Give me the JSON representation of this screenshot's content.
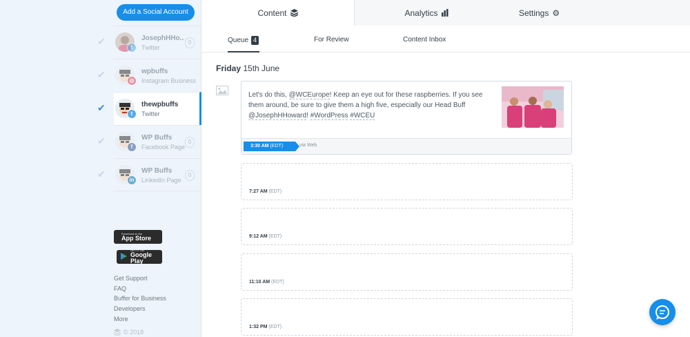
{
  "sidebar": {
    "add_account_label": "Add a Social Account",
    "accounts": [
      {
        "name": "JosephHHo...",
        "type": "Twitter",
        "count": "0",
        "network": "twitter",
        "active": false
      },
      {
        "name": "wpbuffs",
        "type": "Instagram Business",
        "count": "",
        "network": "instagram",
        "active": false
      },
      {
        "name": "thewpbuffs",
        "type": "Twitter",
        "count": "",
        "network": "twitter",
        "active": true
      },
      {
        "name": "WP Buffs",
        "type": "Facebook Page",
        "count": "0",
        "network": "facebook",
        "active": false
      },
      {
        "name": "WP Buffs",
        "type": "LinkedIn Page",
        "count": "0",
        "network": "linkedin",
        "active": false
      }
    ],
    "app_store": {
      "small": "Download on the",
      "big": "App Store"
    },
    "google_play": {
      "small": "GET IT ON",
      "big": "Google Play"
    },
    "footer_links": [
      "Get Support",
      "FAQ",
      "Buffer for Business",
      "Developers",
      "More"
    ],
    "copyright": "© 2018"
  },
  "top_tabs": {
    "content": "Content",
    "analytics": "Analytics",
    "settings": "Settings"
  },
  "sub_tabs": {
    "queue": "Queue",
    "queue_count": "4",
    "for_review": "For Review",
    "content_inbox": "Content Inbox"
  },
  "queue": {
    "day": "Friday",
    "date": "15th June",
    "post": {
      "text_1": "Let's do this, ",
      "mention_1": "@WCEurope",
      "text_2": "! Keep an eye out for these raspberries. If you see them around, be sure to give them a high five, especially our Head Buff ",
      "mention_2": "@JosephHHoward",
      "text_3": "! ",
      "hashtag_1": "#WordPress",
      "text_4": " ",
      "hashtag_2": "#WCEU",
      "time": "3:30 AM",
      "tz": "(EDT)",
      "via": "via Web"
    },
    "slots": [
      {
        "time": "7:27 AM",
        "tz": "(EDT)"
      },
      {
        "time": "9:12 AM",
        "tz": "(EDT)"
      },
      {
        "time": "11:10 AM",
        "tz": "(EDT)"
      },
      {
        "time": "1:32 PM",
        "tz": "(EDT)"
      }
    ]
  },
  "colors": {
    "accent": "#168eea",
    "sidebar_bg": "#eef4fb",
    "twitter": "#55acee",
    "instagram": "#e4405f",
    "facebook": "#3b5998",
    "linkedin": "#0077b5"
  },
  "icons": [
    "layers-icon",
    "bar-chart-icon",
    "gear-icon",
    "check-icon",
    "image-placeholder-icon",
    "chat-icon",
    "apple-icon",
    "google-play-icon",
    "buffer-logo-icon"
  ]
}
